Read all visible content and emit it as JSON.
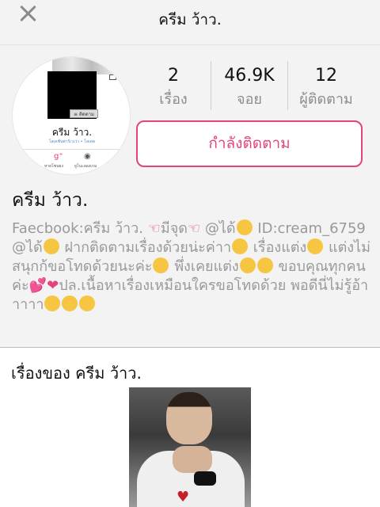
{
  "header": {
    "title": "ครีม ว้าว."
  },
  "avatar": {
    "name": "ครีม ว้าว.",
    "subtitle": "โลเคชั่นพาร์เวเว่ว • โลเคด",
    "follow_mini": "≡ ติดตาม",
    "bottom_labels": [
      "หายโซนยง",
      "ยูโนะลองเกม"
    ]
  },
  "stats": [
    {
      "value": "2",
      "label": "เรื่อง"
    },
    {
      "value": "46.9K",
      "label": "จอย"
    },
    {
      "value": "12",
      "label": "ผู้ติดตาม"
    }
  ],
  "follow_button": "กำลังติดตาม",
  "profile_name": "ครีม ว้าว.",
  "bio": {
    "part1": "Faecbook:ครีม ว้าว. ",
    "part2": "มีจุด",
    "part3": " @ได้",
    "part4": "ID:cream_6759 @ได้",
    "part5": " ฝากติดตามเรื่องด้วยน่ะค่าา",
    "part6": " เรื่องแต่ง",
    "part7": " แต่งไม่สนุกก้ขอโทดด้วยนะค่ะ",
    "part8": "พึ่งเคยแต่ง",
    "part9": " ขอบคุณทุกคนค่ะ",
    "part10": "ปล.เนื้อหาเรื่องเหมือนใครขอโทดด้วย พอดีนี่ไม่รู้อ้าาาาา"
  },
  "works_title": "เรื่องของ ครีม ว้าว.",
  "colors": {
    "accent": "#e0457f",
    "bg": "#f3f3f3",
    "muted": "#999999"
  }
}
